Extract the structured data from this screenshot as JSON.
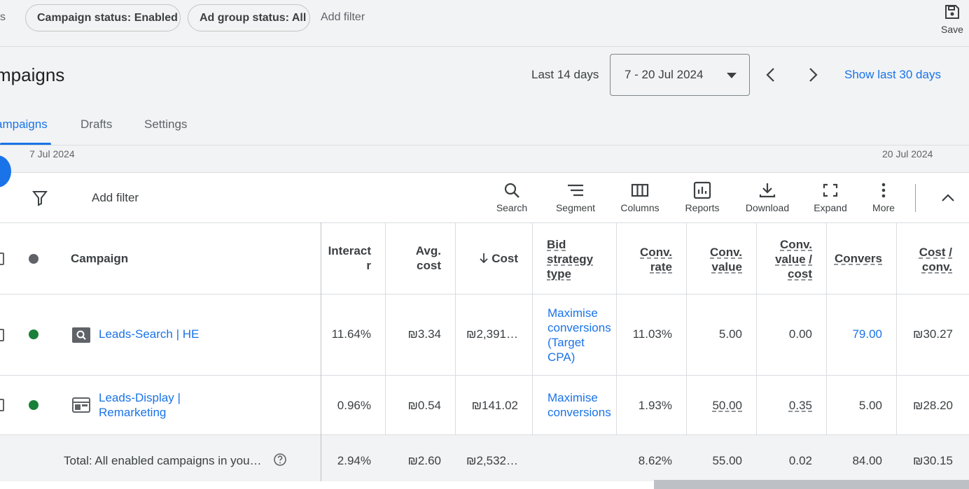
{
  "filters": {
    "partial_left": "s",
    "chips": [
      "Campaign status: Enabled",
      "Ad group status: All"
    ],
    "add_filter": "Add filter",
    "save_label": "Save"
  },
  "header": {
    "title": "mpaigns",
    "period_label": "Last 14 days",
    "date_range": "7 - 20 Jul 2024",
    "show_last_30": "Show last 30 days"
  },
  "tabs": [
    {
      "label": "ampaigns",
      "active": true
    },
    {
      "label": "Drafts",
      "active": false
    },
    {
      "label": "Settings",
      "active": false
    }
  ],
  "chart_axis": {
    "start": "7 Jul 2024",
    "end": "20 Jul 2024"
  },
  "toolbar": {
    "add_filter": "Add filter",
    "buttons": [
      "Search",
      "Segment",
      "Columns",
      "Reports",
      "Download",
      "Expand",
      "More"
    ]
  },
  "table": {
    "headers": {
      "campaign": "Campaign",
      "interaction_rate": [
        "Interact",
        "r"
      ],
      "avg_cost": [
        "Avg.",
        "cost"
      ],
      "cost": "Cost",
      "bid_strategy": [
        "Bid",
        "strategy",
        "type"
      ],
      "conv_rate": [
        "Conv.",
        "rate"
      ],
      "conv_value": [
        "Conv.",
        "value"
      ],
      "conv_value_cost": [
        "Conv.",
        "value /",
        "cost"
      ],
      "conversions": "Convers",
      "cost_conv": [
        "Cost /",
        "conv."
      ]
    },
    "rows": [
      {
        "campaign": "Leads-Search | HE",
        "interaction_rate": "11.64%",
        "avg_cost": "₪3.34",
        "cost": "₪2,391…",
        "bid_strategy": [
          "Maximise",
          "conversions",
          "(Target",
          "CPA)"
        ],
        "conv_rate": "11.03%",
        "conv_value": "5.00",
        "conv_value_cost": "0.00",
        "conversions": "79.00",
        "cost_conv": "₪30.27"
      },
      {
        "campaign": [
          "Leads-Display |",
          "Remarketing"
        ],
        "interaction_rate": "0.96%",
        "avg_cost": "₪0.54",
        "cost": "₪141.02",
        "bid_strategy": [
          "Maximise",
          "conversions"
        ],
        "conv_rate": "1.93%",
        "conv_value": "50.00",
        "conv_value_cost": "0.35",
        "conversions": "5.00",
        "cost_conv": "₪28.20"
      }
    ],
    "total": {
      "label": "Total: All enabled campaigns in you…",
      "interaction_rate": "2.94%",
      "avg_cost": "₪2.60",
      "cost": "₪2,532…",
      "conv_rate": "8.62%",
      "conv_value": "55.00",
      "conv_value_cost": "0.02",
      "conversions": "84.00",
      "cost_conv": "₪30.15"
    }
  },
  "colors": {
    "accent": "#1a73e8",
    "enabled_dot": "#188038",
    "header_dot": "#5f6368"
  }
}
